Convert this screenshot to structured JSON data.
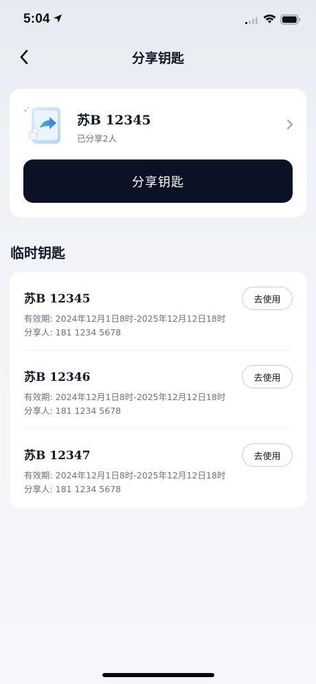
{
  "status_bar": {
    "time": "5:04",
    "icons": [
      "location-arrow-icon",
      "signal-icon",
      "wifi-icon",
      "battery-icon"
    ]
  },
  "nav": {
    "title": "分享钥匙",
    "back_icon": "chevron-left-icon"
  },
  "key_card": {
    "plate": "苏B 12345",
    "shared_count": "已分享2人",
    "share_button": "分享钥匙",
    "illustration": "phone-share-icon"
  },
  "temp_keys": {
    "section_title": "临时钥匙",
    "items": [
      {
        "plate": "苏B 12345",
        "validity": "有效期: 2024年12月1日8时-2025年12月12日18时",
        "sharer": "分享人: 181 1234 5678",
        "button": "去使用"
      },
      {
        "plate": "苏B 12346",
        "validity": "有效期: 2024年12月1日8时-2025年12月12日18时",
        "sharer": "分享人: 181 1234 5678",
        "button": "去使用"
      },
      {
        "plate": "苏B 12347",
        "validity": "有效期: 2024年12月1日8时-2025年12月12日18时",
        "sharer": "分享人: 181 1234 5678",
        "button": "去使用"
      }
    ]
  },
  "colors": {
    "primary_button": "#0b1226",
    "card_bg": "#ffffff",
    "text_primary": "#111827",
    "text_secondary": "#6b7280"
  }
}
